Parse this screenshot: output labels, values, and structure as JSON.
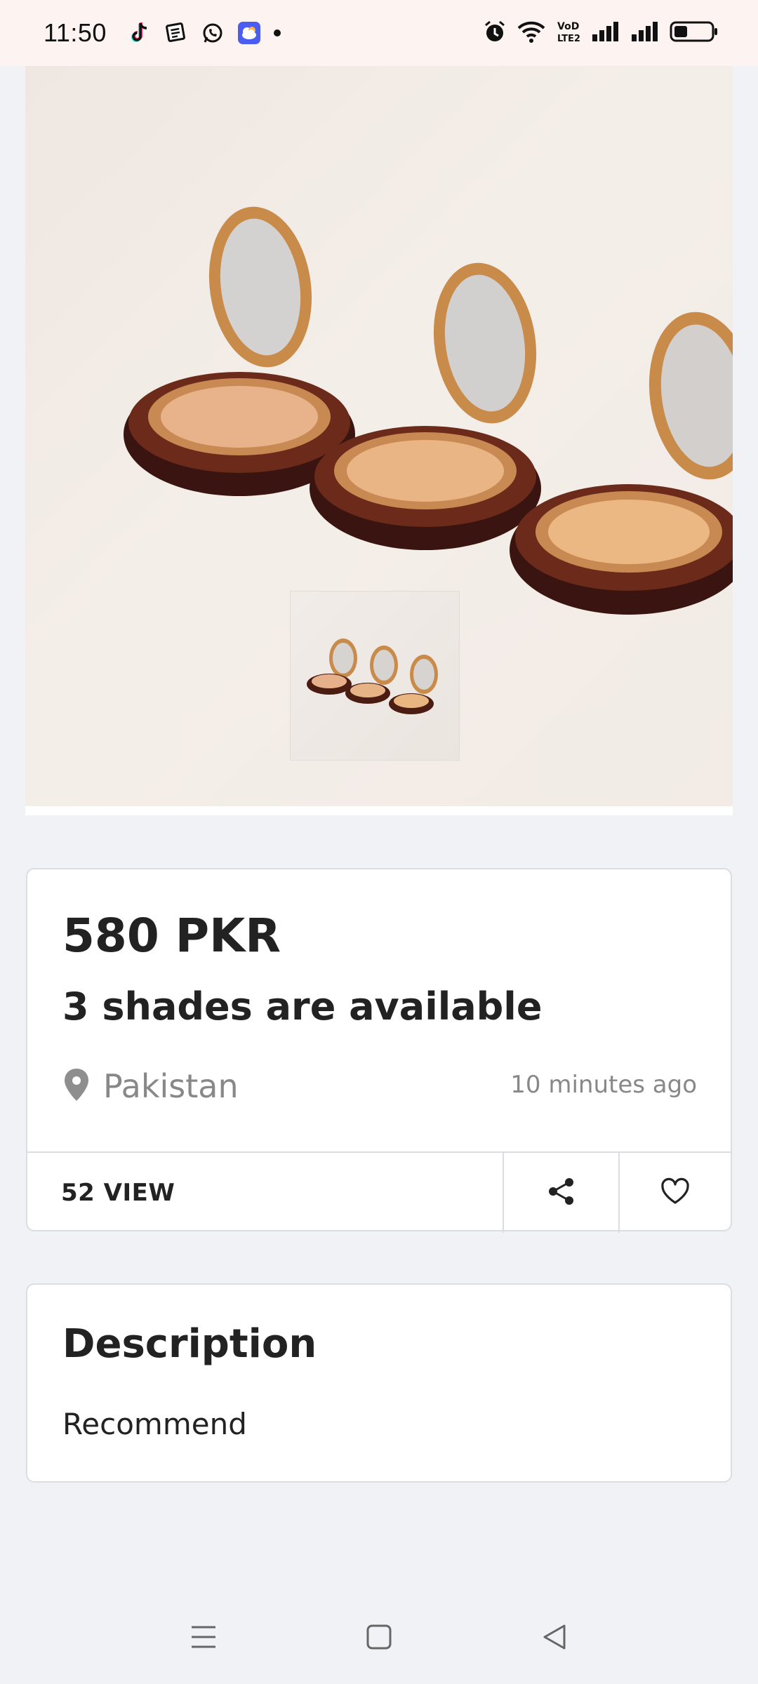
{
  "status_bar": {
    "time": "11:50",
    "app_icons": [
      "tiktok-icon",
      "news-icon",
      "whatsapp-icon",
      "weather-icon"
    ],
    "system_icons": [
      "alarm-icon",
      "wifi-icon",
      "volte-icon",
      "signal-icon",
      "signal-icon",
      "battery-icon"
    ],
    "volte_label": "VoD LTE2"
  },
  "product": {
    "image_alt": "3 compact powder cases",
    "price": "580 PKR",
    "title": "3 shades are available",
    "location": "Pakistan",
    "posted": "10 minutes ago",
    "views": "52 VIEW"
  },
  "description": {
    "heading": "Description",
    "body": "Recommend"
  },
  "nav": [
    "menu-icon",
    "home-icon",
    "back-icon"
  ],
  "colors": {
    "background": "#f1f2f6",
    "card_border": "#dcdde2",
    "text": "#222222",
    "muted": "#888888",
    "status_bar": "#fdf3f1"
  }
}
